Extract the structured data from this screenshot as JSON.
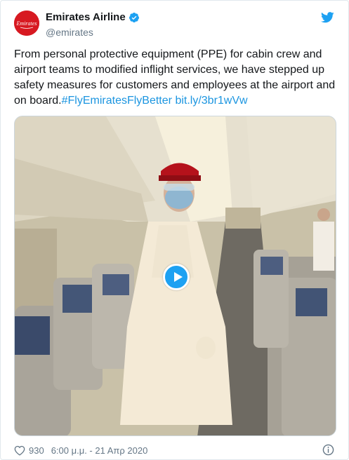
{
  "tweet": {
    "display_name": "Emirates Airline",
    "handle": "@emirates",
    "verified": true,
    "logo_text": "Emirates",
    "text_plain": "From personal protective equipment (PPE) for cabin crew and airport teams to modified inflight services, we have stepped up safety measures for customers and employees at the airport and on board.",
    "hashtag": "#FlyEmiratesFlyBetter",
    "link": "bit.ly/3br1wVw",
    "media_type": "video",
    "likes": "930",
    "timestamp": "6:00 μ.μ. - 21 Απρ 2020"
  },
  "icons": {
    "verified": "verified-badge-icon",
    "platform": "twitter-bird-icon",
    "like": "heart-icon",
    "play": "play-icon",
    "info": "info-icon"
  },
  "colors": {
    "brand_red": "#d71921",
    "link_blue": "#1b95e0",
    "twitter_blue": "#1da1f2",
    "secondary_text": "#657786"
  }
}
